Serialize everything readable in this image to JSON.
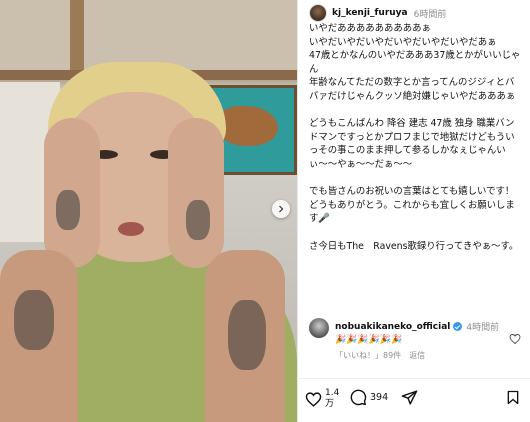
{
  "post": {
    "username": "kj_kenji_furuya",
    "time": "6時間前",
    "caption_lines": [
      "いやだあああああああああぁ",
      "いやだいやだいやだいやだいやだいやだあぁ",
      "47歳とかなんのいやだあああ37歳とかがいいじゃん",
      "年齢なんてただの数字とか言ってんのジジィとババァだけじゃんクッソ絶対嫌じゃいやだあああぁ",
      "",
      "どうもこんばんわ 降谷 建志 47歳 独身 職業バンドマンですっとかプロフまじで地獄だけどもういっその事このまま押して参るしかなぇじゃんいぃ〜〜やぁ〜〜だぁ〜〜",
      "",
      "でも皆さんのお祝いの言葉はとても嬉しいです！",
      "どうもありがとう。これからも宜しくお願いします🎤",
      "",
      "さ今日もThe　Ravens歌録り行ってきやぁ〜す。"
    ]
  },
  "comment": {
    "username": "nobuakikaneko_official",
    "time": "4時間前",
    "emojis": "🎉🎉🎉🎉🎉🎉",
    "likes_text": "「いいね！」89件",
    "reply_label": "返信"
  },
  "actions": {
    "like_count": "1.4万",
    "like_count_top": "1.4",
    "like_count_bottom": "万",
    "comment_count": "394"
  },
  "photo": {
    "description_alt": "photo"
  }
}
